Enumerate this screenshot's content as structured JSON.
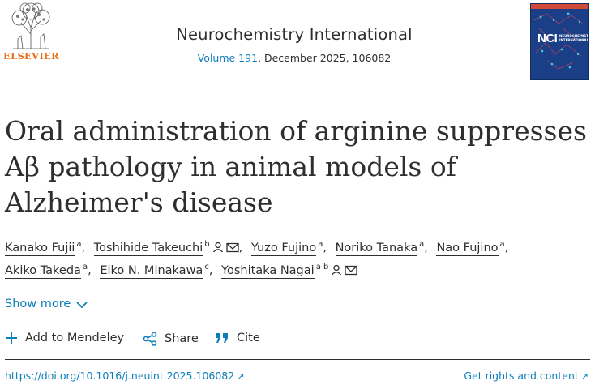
{
  "header": {
    "publisher": "ELSEVIER",
    "journal_title": "Neurochemistry International",
    "volume_link": "Volume 191",
    "issue_detail": ", December 2025, 106082",
    "cover": {
      "abbrev": "NCI",
      "title": "NEUROCHEMISTRY INTERNATIONAL"
    }
  },
  "article": {
    "title_line1": "Oral administration of arginine suppresses",
    "title_line2": "Aβ pathology in animal models of",
    "title_line3": "Alzheimer's disease"
  },
  "authors": [
    {
      "name": "Kanako Fujii",
      "aff": "a"
    },
    {
      "name": "Toshihide Takeuchi",
      "aff": "b"
    },
    {
      "name": "Yuzo Fujino",
      "aff": "a"
    },
    {
      "name": "Noriko Tanaka",
      "aff": "a"
    },
    {
      "name": "Nao Fujino",
      "aff": "a"
    },
    {
      "name": "Akiko Takeda",
      "aff": "a"
    },
    {
      "name": "Eiko N. Minakawa",
      "aff": "c"
    },
    {
      "name": "Yoshitaka Nagai",
      "aff": "a b"
    }
  ],
  "show_more": "Show more",
  "actions": {
    "mendeley": "Add to Mendeley",
    "share": "Share",
    "cite": "Cite"
  },
  "footer": {
    "doi": "https://doi.org/10.1016/j.neuint.2025.106082",
    "rights": "Get rights and content"
  },
  "colors": {
    "link": "#0c7dbb",
    "publisher_orange": "#e9711c",
    "text": "#2e2e2e",
    "cover_bg": "#1b3f86"
  }
}
